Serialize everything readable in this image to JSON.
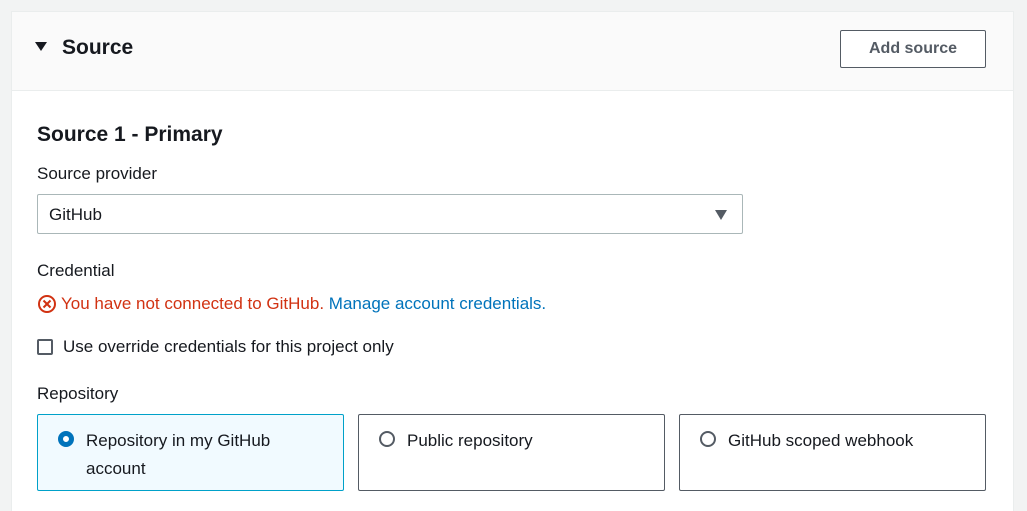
{
  "panel": {
    "title": "Source",
    "add_source_label": "Add source"
  },
  "source": {
    "section_title": "Source 1 - Primary",
    "provider_label": "Source provider",
    "provider_value": "GitHub",
    "credential_label": "Credential",
    "error_message": "You have not connected to GitHub.",
    "manage_link": "Manage account credentials.",
    "override_checkbox_label": "Use override credentials for this project only",
    "override_checked": false,
    "repository_label": "Repository",
    "repository_options": [
      {
        "label": "Repository in my GitHub account",
        "selected": true
      },
      {
        "label": "Public repository",
        "selected": false
      },
      {
        "label": "GitHub scoped webhook",
        "selected": false
      }
    ]
  },
  "colors": {
    "error": "#d13212",
    "link": "#0073bb",
    "selected_tile_bg": "#f1faff",
    "selected_tile_border": "#00a1c9"
  },
  "icons": {
    "collapse": "caret-down-icon",
    "error": "error-circle-x-icon",
    "dropdown": "dropdown-arrow-icon"
  }
}
